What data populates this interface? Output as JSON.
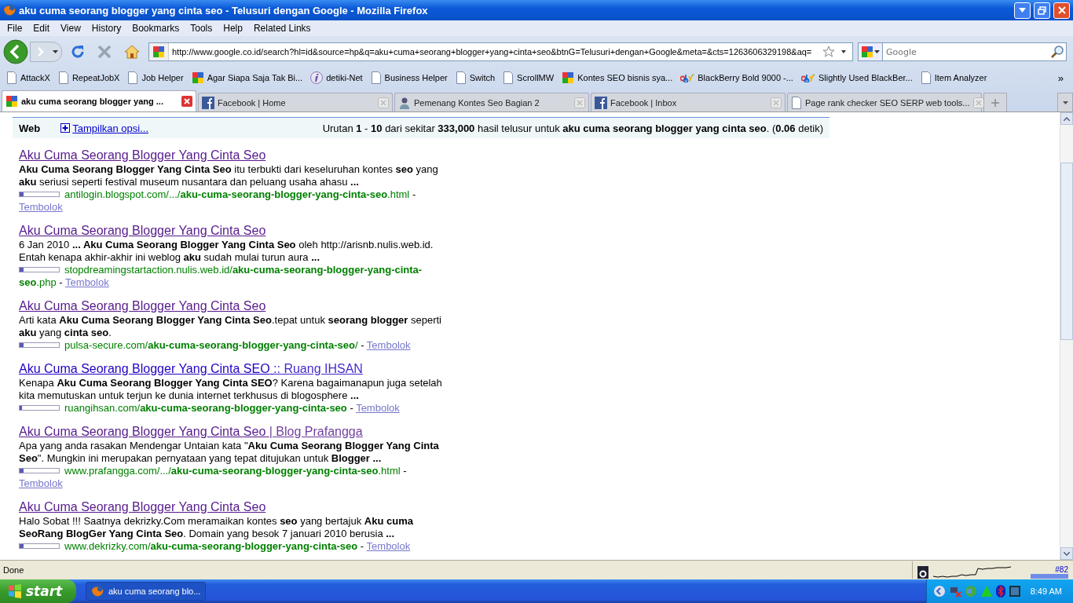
{
  "window": {
    "title": "aku cuma seorang blogger yang cinta seo - Telusuri dengan Google - Mozilla Firefox"
  },
  "menu": [
    "File",
    "Edit",
    "View",
    "History",
    "Bookmarks",
    "Tools",
    "Help",
    "Related Links"
  ],
  "address_bar": {
    "value": "http://www.google.co.id/search?hl=id&source=hp&q=aku+cuma+seorang+blogger+yang+cinta+seo&btnG=Telusuri+dengan+Google&meta=&cts=1263606329198&aq="
  },
  "search_box": {
    "placeholder": "Google"
  },
  "bookmarks": [
    {
      "label": "AttackX",
      "kind": "page"
    },
    {
      "label": "RepeatJobX",
      "kind": "page"
    },
    {
      "label": "Job Helper",
      "kind": "page"
    },
    {
      "label": "Agar Siapa Saja Tak Bi...",
      "kind": "google"
    },
    {
      "label": "detiki-Net",
      "kind": "detiki"
    },
    {
      "label": "Business Helper",
      "kind": "page"
    },
    {
      "label": "Switch",
      "kind": "page"
    },
    {
      "label": "ScrollMW",
      "kind": "page"
    },
    {
      "label": "Kontes SEO bisnis sya...",
      "kind": "google"
    },
    {
      "label": "BlackBerry Bold 9000 -...",
      "kind": "ebay"
    },
    {
      "label": "Slightly Used BlackBer...",
      "kind": "ebay"
    },
    {
      "label": "Item Analyzer",
      "kind": "page"
    }
  ],
  "bookmarks_more": "»",
  "tabs": [
    {
      "label": "aku cuma seorang blogger yang ...",
      "kind": "google",
      "selected": true
    },
    {
      "label": "Facebook | Home",
      "kind": "facebook",
      "selected": false
    },
    {
      "label": "Pemenang Kontes Seo Bagian 2",
      "kind": "person",
      "selected": false
    },
    {
      "label": "Facebook | Inbox",
      "kind": "facebook",
      "selected": false
    },
    {
      "label": "Page rank checker SEO SERP web tools...",
      "kind": "page",
      "selected": false
    }
  ],
  "results_header": {
    "label": "Web",
    "options_link": "Tampilkan opsi...",
    "summary": "Urutan **1** - **10** dari sekitar **333,000** hasil telusur untuk **aku cuma seorang blogger yang cinta seo**. (**0.06** detik)"
  },
  "results": [
    {
      "title": "Aku Cuma Seorang Blogger Yang Cinta Seo",
      "visited": true,
      "snippet": "**Aku Cuma Seorang Blogger Yang Cinta Seo** itu terbukti dari keseluruhan kontes **seo** yang **aku** seriusi seperti festival museum nusantara dan peluang usaha ahasu **...**",
      "url": "antilogin.blogspot.com/.../**aku-cuma-seorang-blogger-yang-cinta-seo**.html",
      "level": 0.1,
      "separator": "-",
      "cache": "Tembolok"
    },
    {
      "title": "Aku Cuma Seorang Blogger Yang Cinta Seo",
      "visited": true,
      "snippet": "6 Jan 2010 **... Aku Cuma Seorang Blogger Yang Cinta Seo** oleh http://arisnb.nulis.web.id. Entah kenapa akhir-akhir ini weblog **aku** sudah mulai turun aura **...**",
      "url": "stopdreamingstartaction.nulis.web.id/**aku-cuma-seorang-blogger-yang-cinta-seo**.php",
      "level": 0.1,
      "separator": "-",
      "cache": "Tembolok"
    },
    {
      "title": "Aku Cuma Seorang Blogger Yang Cinta Seo",
      "visited": true,
      "snippet": "Arti kata **Aku Cuma Seorang Blogger Yang Cinta Seo**.tepat untuk **seorang blogger** seperti **aku** yang **cinta seo**.",
      "url": "pulsa-secure.com/**aku-cuma-seorang-blogger-yang-cinta-seo**/",
      "level": 0.1,
      "separator": "-",
      "cache": "Tembolok"
    },
    {
      "title": "Aku Cuma Seorang Blogger Yang Cinta SEO",
      "title_suffix": ":: Ruang IHSAN",
      "visited": false,
      "snippet": "Kenapa **Aku Cuma Seorang Blogger Yang Cinta SEO**? Karena bagaimanapun juga setelah kita memutuskan untuk terjun ke dunia internet terkhusus di blogosphere **...**",
      "url": "ruangihsan.com/**aku-cuma-seorang-blogger-yang-cinta-seo**",
      "level": 0.05,
      "separator": "-",
      "cache": "Tembolok"
    },
    {
      "title": "Aku Cuma Seorang Blogger Yang Cinta Seo",
      "title_suffix": "| Blog Prafangga",
      "visited": true,
      "snippet": "Apa yang anda rasakan Mendengar Untaian kata \"**Aku Cuma Seorang Blogger Yang Cinta Seo**\". Mungkin ini merupakan pernyataan yang tepat ditujukan untuk **Blogger ...**",
      "url": "www.prafangga.com/.../**aku-cuma-seorang-blogger-yang-cinta-seo**.html",
      "level": 0.1,
      "separator": "-",
      "cache": "Tembolok"
    },
    {
      "title": "Aku Cuma Seorang Blogger Yang Cinta Seo",
      "visited": true,
      "snippet": "Halo Sobat !!! Saatnya dekrizky.Com meramaikan kontes **seo** yang bertajuk **Aku cuma SeoRang BlogGer Yang Cinta Seo**. Domain yang besok 7 januari 2010 berusia **...**",
      "url": "www.dekrizky.com/**aku-cuma-seorang-blogger-yang-cinta-seo**",
      "level": 0.1,
      "separator": "-",
      "cache": "Tembolok"
    }
  ],
  "status_bar": {
    "text": "Done",
    "rank": "#82"
  },
  "taskbar": {
    "start": "start",
    "task": "aku cuma seorang blo...",
    "clock": "8:49 AM"
  }
}
